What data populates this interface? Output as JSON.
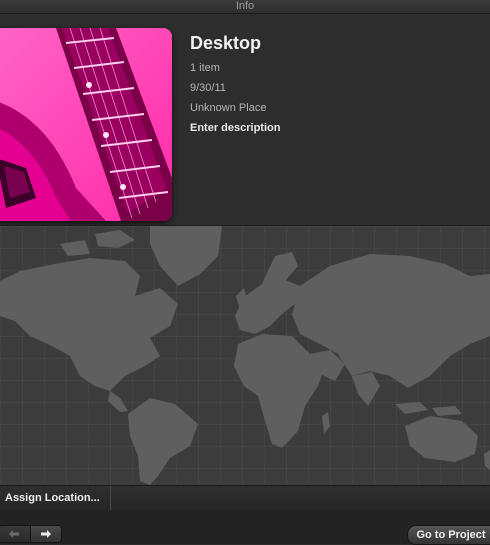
{
  "window": {
    "title": "Info"
  },
  "event": {
    "title": "Desktop",
    "count": "1 item",
    "date": "9/30/11",
    "place": "Unknown Place",
    "description_placeholder": "Enter description"
  },
  "map_bar": {
    "assign_label": "Assign Location..."
  },
  "footer": {
    "goto_label": "Go to Project"
  },
  "icons": {
    "prev": "arrow-left-icon",
    "next": "arrow-right-icon"
  },
  "colors": {
    "thumbnail_accent": "#ff3fb4",
    "map_land": "#5f5f5f",
    "map_water": "#3c3c3c"
  }
}
